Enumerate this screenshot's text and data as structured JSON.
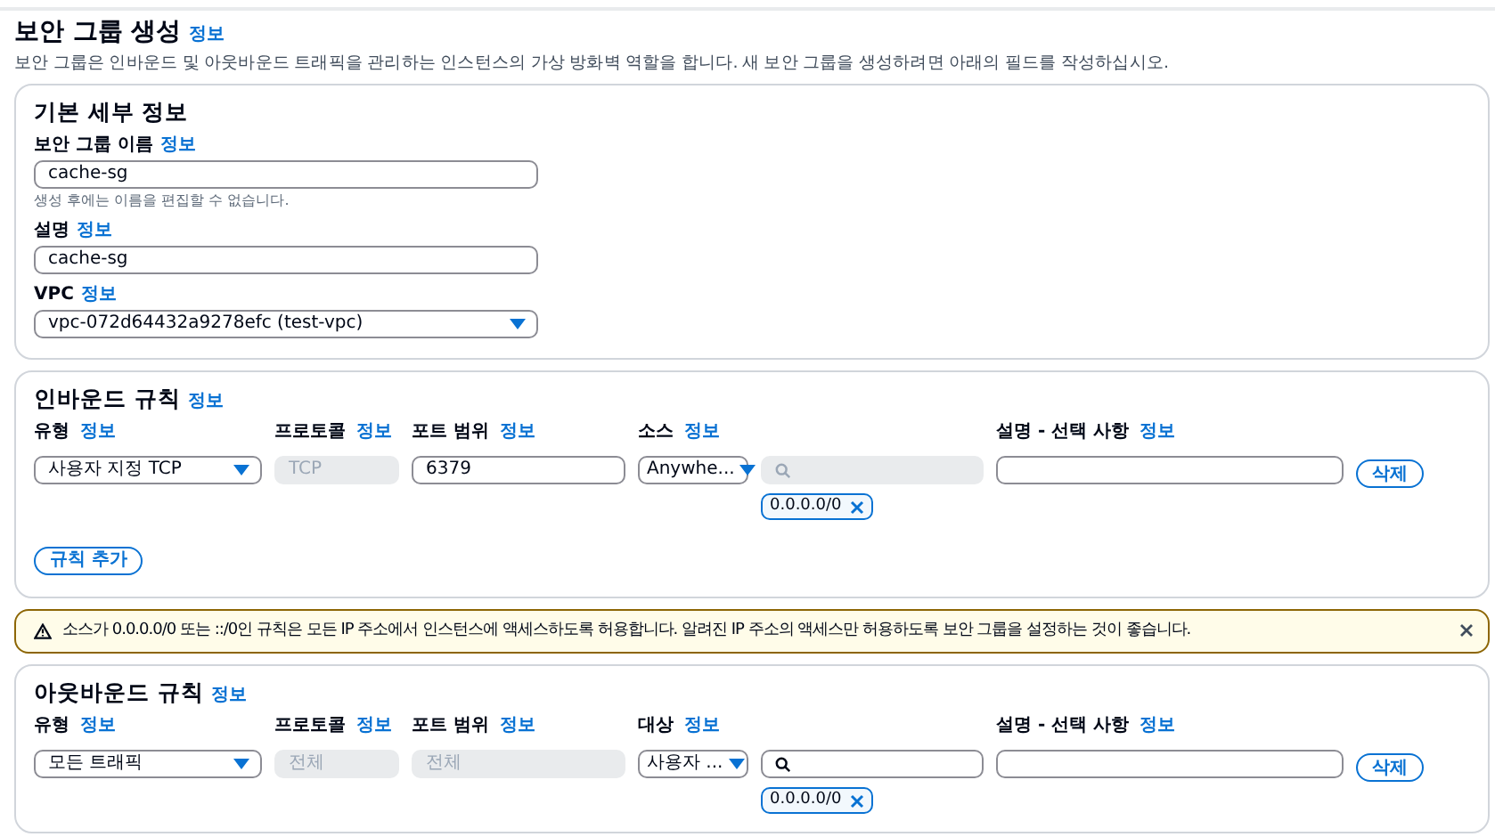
{
  "header": {
    "title": "보안 그룹 생성",
    "info": "정보",
    "description": "보안 그룹은 인바운드 및 아웃바운드 트래픽을 관리하는 인스턴스의 가상 방화벽 역할을 합니다. 새 보안 그룹을 생성하려면 아래의 필드를 작성하십시오."
  },
  "basic_details": {
    "heading": "기본 세부 정보",
    "fields": [
      {
        "kind": "text",
        "label": "보안 그룹 이름",
        "info": "정보",
        "value": "cache-sg",
        "hint": "생성 후에는 이름을 편집할 수 없습니다."
      },
      {
        "kind": "text",
        "label": "설명",
        "info": "정보",
        "value": "cache-sg"
      },
      {
        "kind": "select",
        "label": "VPC",
        "info": "정보",
        "value": "vpc-072d64432a9278efc (test-vpc)"
      }
    ]
  },
  "inbound_rules": {
    "heading": "인바운드 규칙",
    "info": "정보",
    "columns": [
      {
        "label": "유형",
        "info": "정보"
      },
      {
        "label": "프로토콜",
        "info": "정보"
      },
      {
        "label": "포트 범위",
        "info": "정보"
      },
      {
        "label": "소스",
        "info": "정보"
      },
      {
        "label": "설명 - 선택 사항",
        "info": "정보"
      }
    ],
    "rows": [
      {
        "type": "사용자 지정 TCP",
        "protocol": "TCP",
        "protocol_disabled": true,
        "port": "6379",
        "port_disabled": false,
        "target": "Anywhe...",
        "search_disabled": true,
        "chips": [
          "0.0.0.0/0"
        ],
        "delete": "삭제"
      }
    ],
    "add_button": "규칙 추가"
  },
  "alert": {
    "text": "소스가 0.0.0.0/0 또는 ::/0인 규칙은 모든 IP 주소에서 인스턴스에 액세스하도록 허용합니다. 알려진 IP 주소의 액세스만 허용하도록 보안 그룹을 설정하는 것이 좋습니다."
  },
  "outbound_rules": {
    "heading": "아웃바운드 규칙",
    "info": "정보",
    "columns": [
      {
        "label": "유형",
        "info": "정보"
      },
      {
        "label": "프로토콜",
        "info": "정보"
      },
      {
        "label": "포트 범위",
        "info": "정보"
      },
      {
        "label": "대상",
        "info": "정보"
      },
      {
        "label": "설명 - 선택 사항",
        "info": "정보"
      }
    ],
    "rows": [
      {
        "type": "모든 트래픽",
        "protocol": "전체",
        "protocol_disabled": true,
        "port": "전체",
        "port_disabled": true,
        "target": "사용자 ...",
        "search_disabled": false,
        "chips": [
          "0.0.0.0/0"
        ],
        "delete": "삭제"
      }
    ]
  }
}
